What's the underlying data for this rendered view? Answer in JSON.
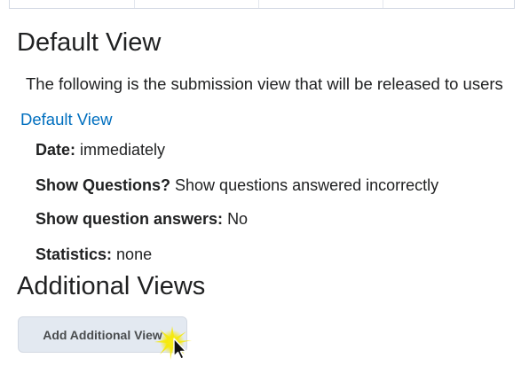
{
  "default_view": {
    "title": "Default View",
    "description": "The following is the submission view that will be released to users",
    "link_label": "Default View",
    "details": [
      {
        "label": "Date:",
        "value": "immediately"
      },
      {
        "label": "Show Questions?",
        "value": "Show questions answered incorrectly"
      },
      {
        "label": "Show question answers:",
        "value": "No"
      },
      {
        "label": "Statistics:",
        "value": "none"
      }
    ]
  },
  "additional_views": {
    "title": "Additional Views",
    "add_button_label": "Add Additional View"
  },
  "colors": {
    "link": "#006fbf",
    "button_bg": "#e3e9f1",
    "cursor_highlight": "#f5e90c"
  },
  "icons": {
    "cursor": "mouse-pointer-icon"
  }
}
